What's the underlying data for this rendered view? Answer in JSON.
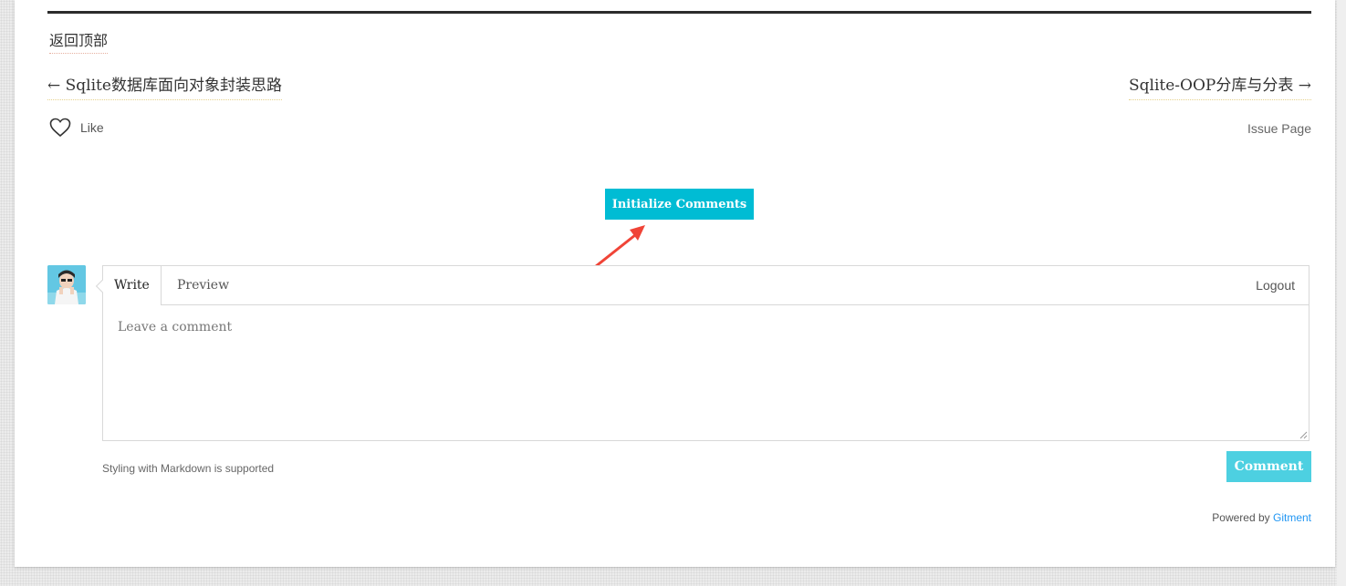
{
  "nav": {
    "back_to_top": "返回顶部",
    "prev_post": "← Sqlite数据库面向对象封装思路",
    "next_post": "Sqlite-OOP分库与分表 →"
  },
  "reactions": {
    "like_label": "Like",
    "issue_page": "Issue Page"
  },
  "init_button": "Initialize Comments",
  "editor": {
    "tabs": [
      {
        "label": "Write",
        "active": true
      },
      {
        "label": "Preview",
        "active": false
      }
    ],
    "logout": "Logout",
    "placeholder": "Leave a comment",
    "value": ""
  },
  "footer": {
    "markdown_note": "Styling with Markdown is supported",
    "comment_button": "Comment",
    "powered_by": "Powered by",
    "gitment_link": "Gitment"
  },
  "colors": {
    "accent": "#00bcd4",
    "comment_button": "#4dd0e1",
    "link": "#2196f3",
    "annotation_arrow": "#f04437"
  },
  "icons": [
    "heart-icon",
    "annotation-arrow-icon",
    "user-avatar"
  ]
}
